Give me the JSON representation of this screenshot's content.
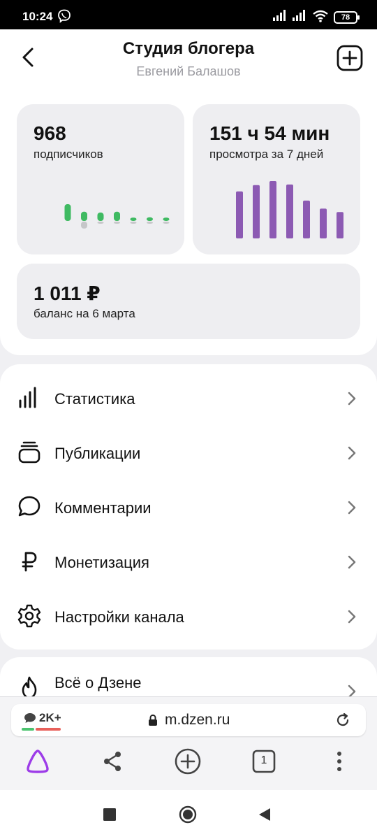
{
  "status_bar": {
    "time": "10:24",
    "battery": "78",
    "icons": [
      "viber-icon",
      "signal-icon",
      "signal-icon",
      "wifi-icon",
      "battery-icon"
    ]
  },
  "header": {
    "title": "Студия блогера",
    "subtitle": "Евгений Балашов",
    "back_icon": "back-arrow-icon",
    "add_icon": "add-square-icon"
  },
  "stats": {
    "subscribers": {
      "value": "968",
      "label": "подписчиков",
      "mini_chart": {
        "bars": [
          {
            "gain": 1.0,
            "loss": 0.0
          },
          {
            "gain": 0.55,
            "loss": 0.55
          },
          {
            "gain": 0.5,
            "loss": 0.15
          },
          {
            "gain": 0.55,
            "loss": 0.12
          },
          {
            "gain": 0.2,
            "loss": 0.12
          },
          {
            "gain": 0.22,
            "loss": 0.12
          },
          {
            "gain": 0.2,
            "loss": 0.12
          }
        ],
        "gain_color": "#3fba62",
        "loss_color": "#c6c6c9"
      }
    },
    "views": {
      "value": "151 ч 54 мин",
      "label": "просмотра за 7 дней",
      "mini_chart": {
        "values": [
          0.82,
          0.93,
          1.0,
          0.94,
          0.66,
          0.52,
          0.46
        ],
        "color": "#8c5ab3"
      }
    },
    "balance": {
      "value": "1 011 ₽",
      "label": "баланс на 6 марта"
    }
  },
  "menu": [
    {
      "label": "Статистика",
      "icon": "bar-chart-icon"
    },
    {
      "label": "Публикации",
      "icon": "stack-icon"
    },
    {
      "label": "Комментарии",
      "icon": "comment-bubble-icon"
    },
    {
      "label": "Монетизация",
      "icon": "ruble-icon"
    },
    {
      "label": "Настройки канала",
      "icon": "gear-icon"
    }
  ],
  "about": {
    "label": "Всё о Дзене",
    "icon": "flame-icon"
  },
  "browser": {
    "comments_count": "2K+",
    "url": "m.dzen.ru",
    "tabs_count": "1",
    "toolbar_icons": [
      "alice-icon",
      "share-icon",
      "new-tab-plus-icon",
      "tabs-icon",
      "more-vertical-icon"
    ],
    "alice_color": "#9d3ce8"
  },
  "nav_bar": {
    "icons": [
      "recents-square-icon",
      "home-circle-icon",
      "back-triangle-icon"
    ]
  }
}
